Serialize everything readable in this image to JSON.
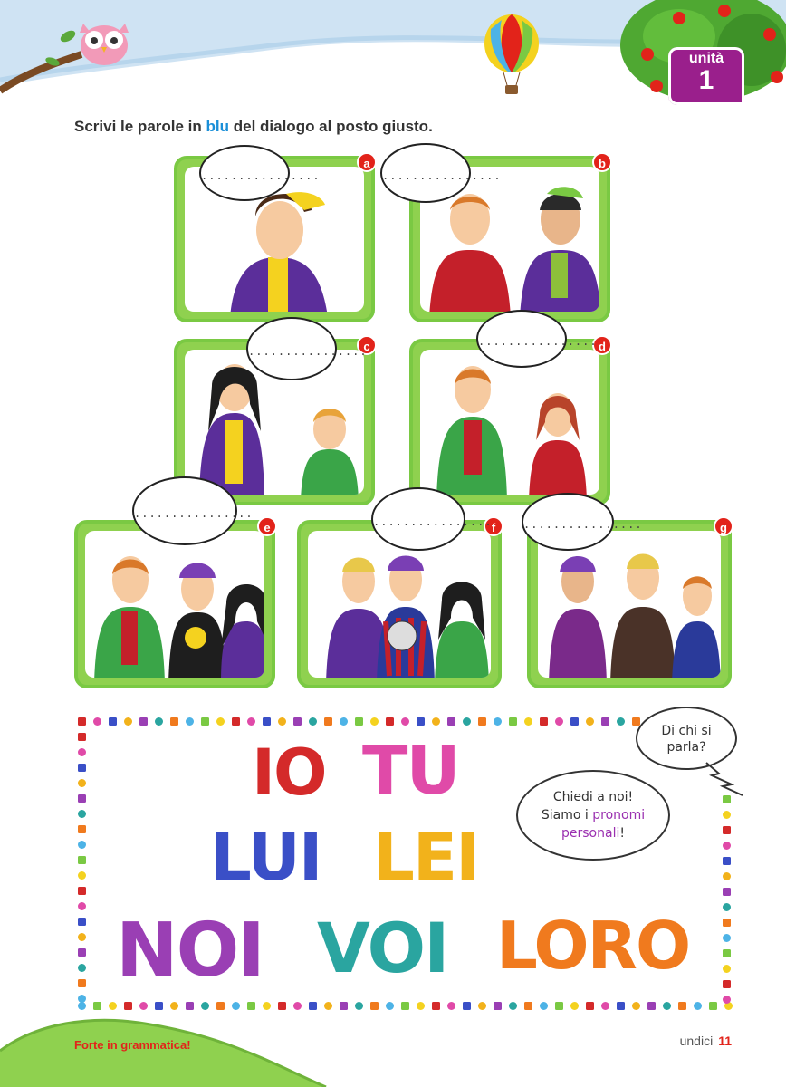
{
  "header": {
    "unit_label": "unità",
    "unit_number": "1"
  },
  "instruction": {
    "before": "Scrivi le parole in ",
    "highlight": "blu",
    "after": " del dialogo al posto giusto."
  },
  "panels": [
    {
      "letter": "a",
      "blank": "................"
    },
    {
      "letter": "b",
      "blank": "................"
    },
    {
      "letter": "c",
      "blank": "................"
    },
    {
      "letter": "d",
      "blank": "................"
    },
    {
      "letter": "e",
      "blank": "................"
    },
    {
      "letter": "f",
      "blank": "................"
    },
    {
      "letter": "g",
      "blank": "................"
    }
  ],
  "pronouns": {
    "words": [
      "IO",
      "TU",
      "LUI",
      "LEI",
      "NOI",
      "VOI",
      "LORO"
    ],
    "colors": [
      "#d42a2a",
      "#e04aa8",
      "#3a4fc7",
      "#f2b21b",
      "#9a3fb4",
      "#2aa5a0",
      "#f07a1e"
    ],
    "bubble_question": "Di chi si parla?",
    "bubble_answer_line1": "Chiedi a noi!",
    "bubble_answer_line2": "Siamo i",
    "bubble_answer_highlight1": "pronomi",
    "bubble_answer_highlight2": "personali",
    "bubble_answer_end": "!"
  },
  "footer": {
    "left": "Forte in grammatica!",
    "right_word": "undici",
    "page_number": "11"
  },
  "colors": {
    "green": "#7ac943",
    "red": "#e2231a",
    "purple": "#9a1f8c",
    "blue": "#1a8fd8"
  }
}
